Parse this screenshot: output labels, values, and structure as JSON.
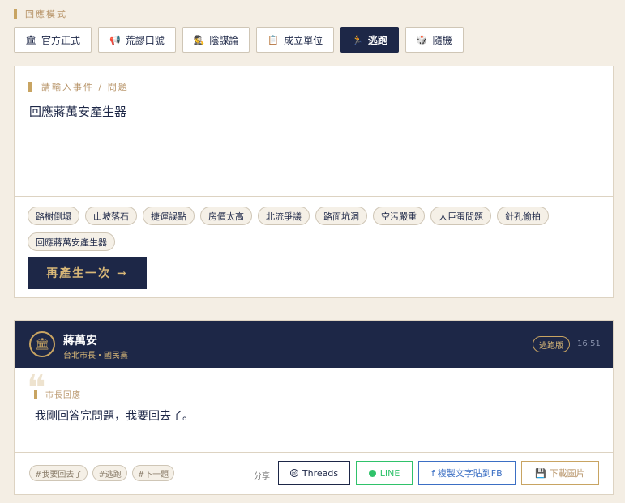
{
  "mode_section": {
    "label": "回應模式",
    "modes": [
      {
        "icon": "🏛",
        "label": "官方正式",
        "active": false
      },
      {
        "icon": "📢",
        "label": "荒謬口號",
        "active": false
      },
      {
        "icon": "🕵",
        "label": "陰謀論",
        "active": false
      },
      {
        "icon": "📋",
        "label": "成立單位",
        "active": false
      },
      {
        "icon": "🏃",
        "label": "逃跑",
        "active": true
      },
      {
        "icon": "🎲",
        "label": "隨機",
        "active": false
      }
    ]
  },
  "input": {
    "label": "請輸入事件 / 問題",
    "value": "回應蔣萬安產生器",
    "chips": [
      "路樹倒塌",
      "山坡落石",
      "捷運誤點",
      "房價太高",
      "北流爭議",
      "路面坑洞",
      "空污嚴重",
      "大巨蛋問題",
      "針孔偷拍",
      "回應蔣萬安產生器"
    ],
    "regenerate_label": "再產生一次 →"
  },
  "result": {
    "avatar_icon": "🏛",
    "name": "蔣萬安",
    "title": "台北市長・國民黨",
    "version_badge": "逃跑版",
    "time": "16:51",
    "quote_mark": "❝",
    "reply_label": "市長回應",
    "reply_text": "我剛回答完問題，我要回去了。",
    "tags": [
      "#我要回去了",
      "#逃跑",
      "#下一題"
    ],
    "share_label": "分享",
    "share_threads": "Threads",
    "share_threads_icon": "@",
    "share_line": "LINE",
    "share_fb": "f 複製文字貼到FB",
    "share_download": "💾 下載圖片"
  },
  "colors": {
    "navy": "#1d2747",
    "gold": "#c8a462",
    "background": "#f4eee4",
    "line_green": "#2fc26a",
    "fb_blue": "#3b6fc4"
  }
}
